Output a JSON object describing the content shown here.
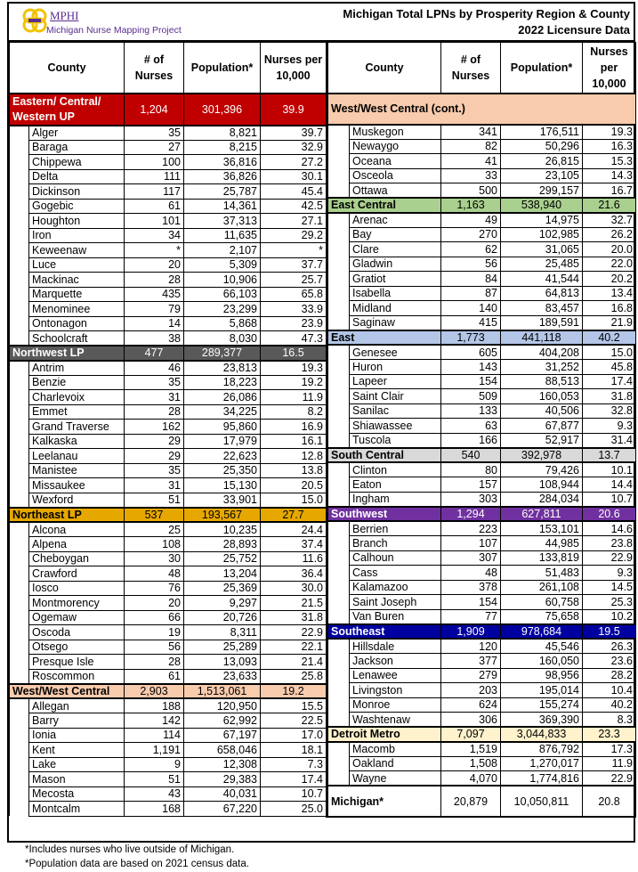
{
  "header": {
    "logo_text": "MPHI",
    "project": "Michigan Nurse Mapping Project",
    "title": "Michigan Total LPNs by Prosperity Region & County",
    "subtitle": "2022 Licensure Data"
  },
  "columns": {
    "left": [
      "County",
      "# of Nurses",
      "Population*",
      "Nurses per 10,000"
    ],
    "right": [
      "County",
      "# of Nurses",
      "Population*",
      "Nurses per 10,000"
    ]
  },
  "left": [
    {
      "name": "Eastern/ Central/ Western UP",
      "nurses": "1,204",
      "population": "301,396",
      "per10k": "39.9",
      "color": "#c00000",
      "text": "#ffffff",
      "counties": [
        [
          "Alger",
          "35",
          "8,821",
          "39.7"
        ],
        [
          "Baraga",
          "27",
          "8,215",
          "32.9"
        ],
        [
          "Chippewa",
          "100",
          "36,816",
          "27.2"
        ],
        [
          "Delta",
          "111",
          "36,826",
          "30.1"
        ],
        [
          "Dickinson",
          "117",
          "25,787",
          "45.4"
        ],
        [
          "Gogebic",
          "61",
          "14,361",
          "42.5"
        ],
        [
          "Houghton",
          "101",
          "37,313",
          "27.1"
        ],
        [
          "Iron",
          "34",
          "11,635",
          "29.2"
        ],
        [
          "Keweenaw",
          "*",
          "2,107",
          "*"
        ],
        [
          "Luce",
          "20",
          "5,309",
          "37.7"
        ],
        [
          "Mackinac",
          "28",
          "10,906",
          "25.7"
        ],
        [
          "Marquette",
          "435",
          "66,103",
          "65.8"
        ],
        [
          "Menominee",
          "79",
          "23,299",
          "33.9"
        ],
        [
          "Ontonagon",
          "14",
          "5,868",
          "23.9"
        ],
        [
          "Schoolcraft",
          "38",
          "8,030",
          "47.3"
        ]
      ]
    },
    {
      "name": "Northwest LP",
      "nurses": "477",
      "population": "289,377",
      "per10k": "16.5",
      "color": "#595959",
      "text": "#ffffff",
      "counties": [
        [
          "Antrim",
          "46",
          "23,813",
          "19.3"
        ],
        [
          "Benzie",
          "35",
          "18,223",
          "19.2"
        ],
        [
          "Charlevoix",
          "31",
          "26,086",
          "11.9"
        ],
        [
          "Emmet",
          "28",
          "34,225",
          "8.2"
        ],
        [
          "Grand Traverse",
          "162",
          "95,860",
          "16.9"
        ],
        [
          "Kalkaska",
          "29",
          "17,979",
          "16.1"
        ],
        [
          "Leelanau",
          "29",
          "22,623",
          "12.8"
        ],
        [
          "Manistee",
          "35",
          "25,350",
          "13.8"
        ],
        [
          "Missaukee",
          "31",
          "15,130",
          "20.5"
        ],
        [
          "Wexford",
          "51",
          "33,901",
          "15.0"
        ]
      ]
    },
    {
      "name": "Northeast LP",
      "nurses": "537",
      "population": "193,567",
      "per10k": "27.7",
      "color": "#e6a800",
      "text": "#000000",
      "counties": [
        [
          "Alcona",
          "25",
          "10,235",
          "24.4"
        ],
        [
          "Alpena",
          "108",
          "28,893",
          "37.4"
        ],
        [
          "Cheboygan",
          "30",
          "25,752",
          "11.6"
        ],
        [
          "Crawford",
          "48",
          "13,204",
          "36.4"
        ],
        [
          "Iosco",
          "76",
          "25,369",
          "30.0"
        ],
        [
          "Montmorency",
          "20",
          "9,297",
          "21.5"
        ],
        [
          "Ogemaw",
          "66",
          "20,726",
          "31.8"
        ],
        [
          "Oscoda",
          "19",
          "8,311",
          "22.9"
        ],
        [
          "Otsego",
          "56",
          "25,289",
          "22.1"
        ],
        [
          "Presque Isle",
          "28",
          "13,093",
          "21.4"
        ],
        [
          "Roscommon",
          "61",
          "23,633",
          "25.8"
        ]
      ]
    },
    {
      "name": "West/West Central",
      "nurses": "2,903",
      "population": "1,513,061",
      "per10k": "19.2",
      "color": "#f8cbad",
      "text": "#000000",
      "counties": [
        [
          "Allegan",
          "188",
          "120,950",
          "15.5"
        ],
        [
          "Barry",
          "142",
          "62,992",
          "22.5"
        ],
        [
          "Ionia",
          "114",
          "67,197",
          "17.0"
        ],
        [
          "Kent",
          "1,191",
          "658,046",
          "18.1"
        ],
        [
          "Lake",
          "9",
          "12,308",
          "7.3"
        ],
        [
          "Mason",
          "51",
          "29,383",
          "17.4"
        ],
        [
          "Mecosta",
          "43",
          "40,031",
          "10.7"
        ],
        [
          "Montcalm",
          "168",
          "67,220",
          "25.0"
        ]
      ]
    }
  ],
  "right_cont": {
    "name": "West/West Central (cont.)",
    "color": "#f8cbad",
    "counties": [
      [
        "Muskegon",
        "341",
        "176,511",
        "19.3"
      ],
      [
        "Newaygo",
        "82",
        "50,296",
        "16.3"
      ],
      [
        "Oceana",
        "41",
        "26,815",
        "15.3"
      ],
      [
        "Osceola",
        "33",
        "23,105",
        "14.3"
      ],
      [
        "Ottawa",
        "500",
        "299,157",
        "16.7"
      ]
    ]
  },
  "right": [
    {
      "name": "East Central",
      "nurses": "1,163",
      "population": "538,940",
      "per10k": "21.6",
      "color": "#a9d08e",
      "text": "#000000",
      "counties": [
        [
          "Arenac",
          "49",
          "14,975",
          "32.7"
        ],
        [
          "Bay",
          "270",
          "102,985",
          "26.2"
        ],
        [
          "Clare",
          "62",
          "31,065",
          "20.0"
        ],
        [
          "Gladwin",
          "56",
          "25,485",
          "22.0"
        ],
        [
          "Gratiot",
          "84",
          "41,544",
          "20.2"
        ],
        [
          "Isabella",
          "87",
          "64,813",
          "13.4"
        ],
        [
          "Midland",
          "140",
          "83,457",
          "16.8"
        ],
        [
          "Saginaw",
          "415",
          "189,591",
          "21.9"
        ]
      ]
    },
    {
      "name": "East",
      "nurses": "1,773",
      "population": "441,118",
      "per10k": "40.2",
      "color": "#b4c6e7",
      "text": "#000000",
      "counties": [
        [
          "Genesee",
          "605",
          "404,208",
          "15.0"
        ],
        [
          "Huron",
          "143",
          "31,252",
          "45.8"
        ],
        [
          "Lapeer",
          "154",
          "88,513",
          "17.4"
        ],
        [
          "Saint Clair",
          "509",
          "160,053",
          "31.8"
        ],
        [
          "Sanilac",
          "133",
          "40,506",
          "32.8"
        ],
        [
          "Shiawassee",
          "63",
          "67,877",
          "9.3"
        ],
        [
          "Tuscola",
          "166",
          "52,917",
          "31.4"
        ]
      ]
    },
    {
      "name": "South Central",
      "nurses": "540",
      "population": "392,978",
      "per10k": "13.7",
      "color": "#d9d9d9",
      "text": "#000000",
      "counties": [
        [
          "Clinton",
          "80",
          "79,426",
          "10.1"
        ],
        [
          "Eaton",
          "157",
          "108,944",
          "14.4"
        ],
        [
          "Ingham",
          "303",
          "284,034",
          "10.7"
        ]
      ]
    },
    {
      "name": "Southwest",
      "nurses": "1,294",
      "population": "627,811",
      "per10k": "20.6",
      "color": "#7030a0",
      "text": "#ffffff",
      "counties": [
        [
          "Berrien",
          "223",
          "153,101",
          "14.6"
        ],
        [
          "Branch",
          "107",
          "44,985",
          "23.8"
        ],
        [
          "Calhoun",
          "307",
          "133,819",
          "22.9"
        ],
        [
          "Cass",
          "48",
          "51,483",
          "9.3"
        ],
        [
          "Kalamazoo",
          "378",
          "261,108",
          "14.5"
        ],
        [
          "Saint Joseph",
          "154",
          "60,758",
          "25.3"
        ],
        [
          "Van Buren",
          "77",
          "75,658",
          "10.2"
        ]
      ]
    },
    {
      "name": "Southeast",
      "nurses": "1,909",
      "population": "978,684",
      "per10k": "19.5",
      "color": "#0000a0",
      "text": "#ffffff",
      "counties": [
        [
          "Hillsdale",
          "120",
          "45,546",
          "26.3"
        ],
        [
          "Jackson",
          "377",
          "160,050",
          "23.6"
        ],
        [
          "Lenawee",
          "279",
          "98,956",
          "28.2"
        ],
        [
          "Livingston",
          "203",
          "195,014",
          "10.4"
        ],
        [
          "Monroe",
          "624",
          "155,274",
          "40.2"
        ],
        [
          "Washtenaw",
          "306",
          "369,390",
          "8.3"
        ]
      ]
    },
    {
      "name": "Detroit Metro",
      "nurses": "7,097",
      "population": "3,044,833",
      "per10k": "23.3",
      "color": "#fff2cc",
      "text": "#000000",
      "counties": [
        [
          "Macomb",
          "1,519",
          "876,792",
          "17.3"
        ],
        [
          "Oakland",
          "1,508",
          "1,270,017",
          "11.9"
        ],
        [
          "Wayne",
          "4,070",
          "1,774,816",
          "22.9"
        ]
      ]
    }
  ],
  "total": {
    "name": "Michigan*",
    "nurses": "20,879",
    "population": "10,050,811",
    "per10k": "20.8"
  },
  "footnotes": [
    "*Includes nurses who live outside of Michigan.",
    "*Population data are based on 2021 census data."
  ]
}
